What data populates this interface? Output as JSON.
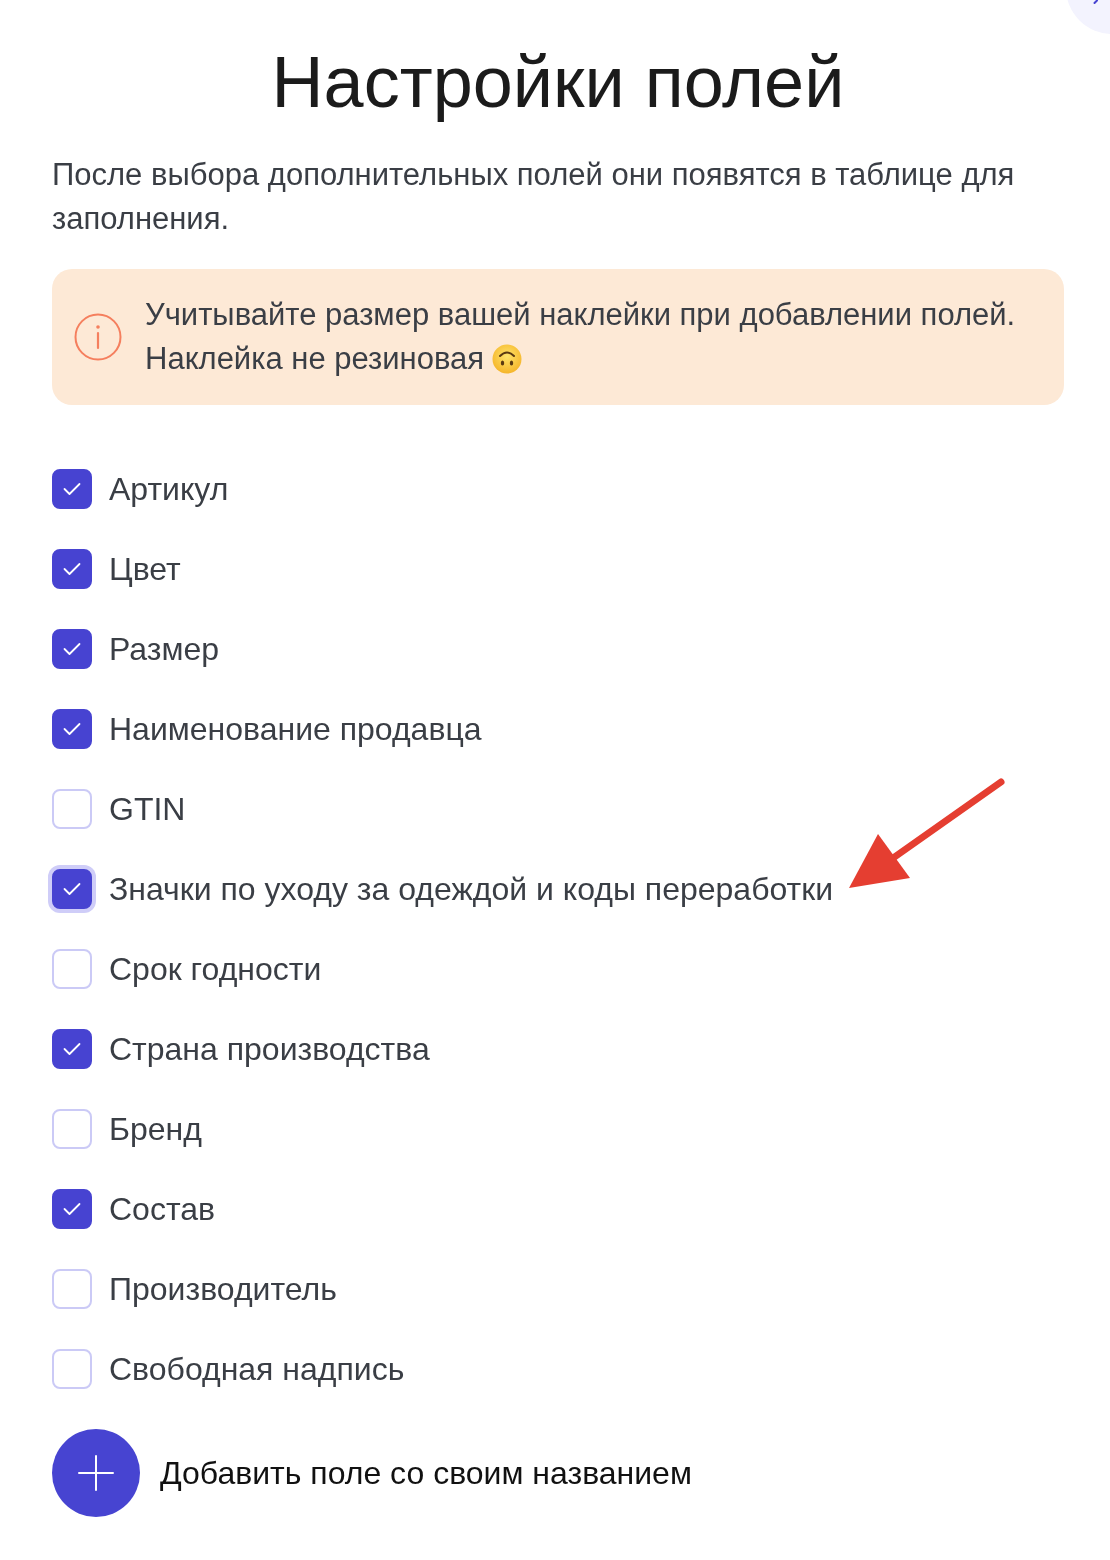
{
  "title": "Настройки полей",
  "description": "После выбора дополнительных полей они появятся в таблице для заполнения.",
  "alert": {
    "lines": [
      "Учитывайте размер вашей наклейки при добавлении полей.",
      "Наклейка не резиновая"
    ]
  },
  "fields": [
    {
      "label": "Артикул",
      "checked": true,
      "focused": false
    },
    {
      "label": "Цвет",
      "checked": true,
      "focused": false
    },
    {
      "label": "Размер",
      "checked": true,
      "focused": false
    },
    {
      "label": "Наименование продавца",
      "checked": true,
      "focused": false
    },
    {
      "label": "GTIN",
      "checked": false,
      "focused": false
    },
    {
      "label": "Значки по уходу за одеждой и коды переработки",
      "checked": true,
      "focused": true
    },
    {
      "label": "Срок годности",
      "checked": false,
      "focused": false
    },
    {
      "label": "Страна производства",
      "checked": true,
      "focused": false
    },
    {
      "label": "Бренд",
      "checked": false,
      "focused": false
    },
    {
      "label": "Состав",
      "checked": true,
      "focused": false
    },
    {
      "label": "Производитель",
      "checked": false,
      "focused": false
    },
    {
      "label": "Свободная надпись",
      "checked": false,
      "focused": false
    }
  ],
  "add_field": {
    "label": "Добавить поле со своим названием"
  }
}
